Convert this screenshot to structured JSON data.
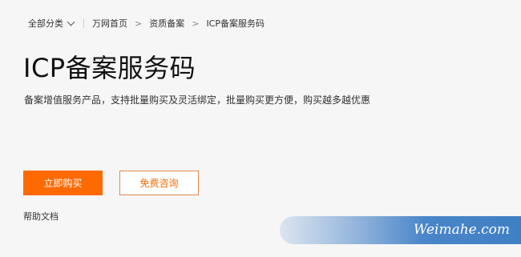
{
  "nav": {
    "all_categories": "全部分类",
    "breadcrumb": [
      "万网首页",
      "资质备案",
      "ICP备案服务码"
    ],
    "separator": ">"
  },
  "hero": {
    "title": "ICP备案服务码",
    "subtitle": "备案增值服务产品，支持批量购买及灵活绑定，批量购买更方便，购买越多越优惠"
  },
  "actions": {
    "buy_label": "立即购买",
    "consult_label": "免费咨询",
    "help_label": "帮助文档"
  },
  "watermark": {
    "text": "Weimahe.com"
  },
  "colors": {
    "accent": "#ff6a00",
    "background": "#f6f6f6",
    "watermark_blue": "#4a86c9"
  }
}
